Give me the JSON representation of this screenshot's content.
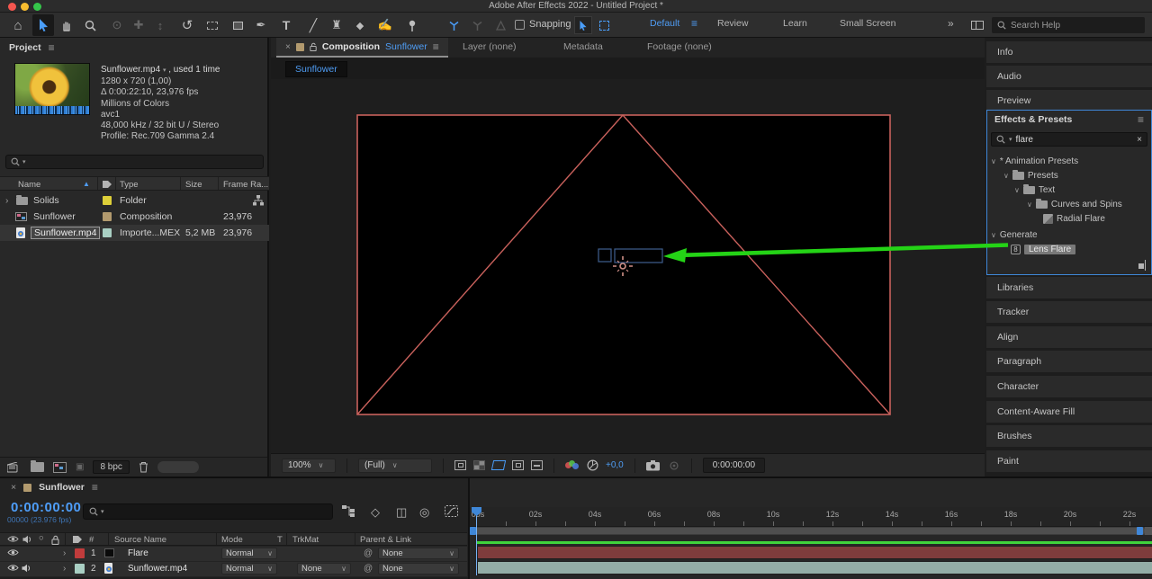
{
  "window": {
    "title": "Adobe After Effects 2022 - Untitled Project *"
  },
  "glyphs": {
    "menu": "≡",
    "close": "×",
    "chevron_down": "∨",
    "dropdown": "▾",
    "expander": "›",
    "sort_asc": "▲",
    "home": "⌂",
    "rotate": "↺",
    "orbit": "⊙",
    "pan": "✚",
    "dolly": "↕",
    "pen": "✒",
    "type_tool": "T",
    "brush": "╱",
    "stamp": "♜",
    "eraser": "◆",
    "roto": "✍",
    "overflow": "»",
    "pickwhip": "@",
    "solo": "○",
    "proxy": "▣",
    "frame_blend": "◫",
    "motion_blur": "◎",
    "draft_3d": "◇"
  },
  "toolbar": {
    "snapping_label": "Snapping",
    "workspaces": {
      "active": "Default",
      "items": [
        "Review",
        "Learn",
        "Small Screen"
      ]
    },
    "help_search_placeholder": "Search Help"
  },
  "project": {
    "tab": "Project",
    "preview": {
      "name": "Sunflower.mp4",
      "used": ", used 1 time",
      "lines": [
        "1280 x 720 (1,00)",
        "Δ 0:00:22:10, 23,976 fps",
        "Millions of Colors",
        "avc1",
        "48,000 kHz / 32 bit U / Stereo",
        "Profile: Rec.709 Gamma 2.4"
      ]
    },
    "columns": {
      "name": "Name",
      "type": "Type",
      "size": "Size",
      "frame_rate": "Frame Ra..."
    },
    "rows": [
      {
        "name": "Solids",
        "type": "Folder",
        "size": "",
        "frame_rate": "",
        "label_color": "#ddcf39"
      },
      {
        "name": "Sunflower",
        "type": "Composition",
        "size": "",
        "frame_rate": "23,976",
        "label_color": "#b29a6e"
      },
      {
        "name": "Sunflower.mp4",
        "type": "Importe...MEX",
        "size": "5,2 MB",
        "frame_rate": "23,976",
        "label_color": "#a9cfc3"
      }
    ],
    "footer": {
      "bpc": "8 bpc"
    }
  },
  "viewer": {
    "tabs": {
      "active_label": "Composition",
      "active_comp": "Sunflower",
      "layer": "Layer (none)",
      "metadata": "Metadata",
      "footage": "Footage (none)"
    },
    "flowchart_comp": "Sunflower",
    "footer": {
      "zoom": "100%",
      "resolution": "(Full)",
      "exposure": "+0,0",
      "timecode": "0:00:00:00"
    }
  },
  "sidebar": {
    "top": [
      "Info",
      "Audio",
      "Preview"
    ],
    "bottom": [
      "Libraries",
      "Tracker",
      "Align",
      "Paragraph",
      "Character",
      "Content-Aware Fill",
      "Brushes",
      "Paint"
    ]
  },
  "effects": {
    "title": "Effects & Presets",
    "search_value": "flare",
    "bpc_badge": "8",
    "tree": [
      {
        "label": "* Animation Presets"
      },
      {
        "label": "Presets"
      },
      {
        "label": "Text"
      },
      {
        "label": "Curves and Spins"
      },
      {
        "label": "Radial Flare"
      },
      {
        "label": "Generate"
      },
      {
        "label": "Lens Flare"
      }
    ]
  },
  "timeline": {
    "tab": "Sunflower",
    "timecode": "0:00:00:00",
    "frames_info": "00000 (23.976 fps)",
    "columns": {
      "number": "#",
      "source": "Source Name",
      "mode": "Mode",
      "t": "T",
      "trkmat": "TrkMat",
      "parent": "Parent & Link"
    },
    "layers": [
      {
        "number": "1",
        "name": "Flare",
        "mode": "Normal",
        "trkmat": "",
        "parent": "None",
        "label_color": "#c13c3c",
        "bar_color": "#7e3c3c"
      },
      {
        "number": "2",
        "name": "Sunflower.mp4",
        "mode": "Normal",
        "trkmat": "None",
        "parent": "None",
        "label_color": "#a9cfc3",
        "bar_color": "#93ada6"
      }
    ],
    "ruler": [
      "00s",
      "02s",
      "04s",
      "06s",
      "08s",
      "10s",
      "12s",
      "14s",
      "16s",
      "18s",
      "20s",
      "22s"
    ]
  },
  "colors": {
    "accent_blue": "#3f9df8",
    "timecode_blue": "#4e9df8",
    "green_arrow": "#24d316",
    "comp_outline": "#c9615c",
    "render_bar_green": "#3fd23c"
  }
}
